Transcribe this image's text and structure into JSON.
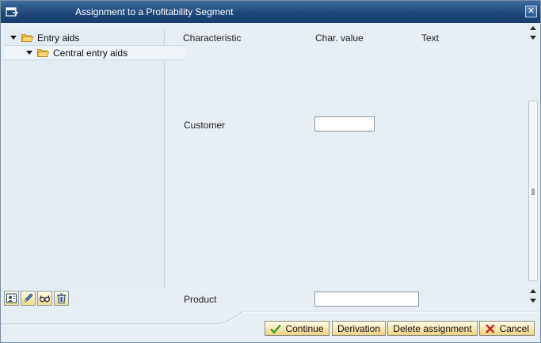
{
  "window": {
    "title": "Assignment to a Profitability Segment",
    "close_symbol": "✕"
  },
  "tree": {
    "items": [
      {
        "label": "Entry aids",
        "icon": "folder-open-icon",
        "level": 0,
        "expanded": true
      },
      {
        "label": "Central entry aids",
        "icon": "folder-open-icon",
        "level": 1,
        "expanded": true
      }
    ],
    "toolbar": [
      {
        "icon": "user-data-icon"
      },
      {
        "icon": "pencil-icon"
      },
      {
        "icon": "glasses-icon"
      },
      {
        "icon": "trash-icon"
      }
    ]
  },
  "columns": {
    "characteristic": "Characteristic",
    "char_value": "Char. value",
    "text": "Text"
  },
  "fields": {
    "customer": {
      "label": "Customer",
      "value": ""
    },
    "product": {
      "label": "Product",
      "value": ""
    }
  },
  "buttons": {
    "continue": "Continue",
    "derivation": "Derivation",
    "delete_assignment": "Delete assignment",
    "cancel": "Cancel"
  },
  "colors": {
    "titlebar": "#20487c",
    "button_face": "#f6e3a8",
    "accept_green": "#3a9a2a",
    "cancel_red": "#cc2a1a",
    "folder": "#f0a52a"
  }
}
